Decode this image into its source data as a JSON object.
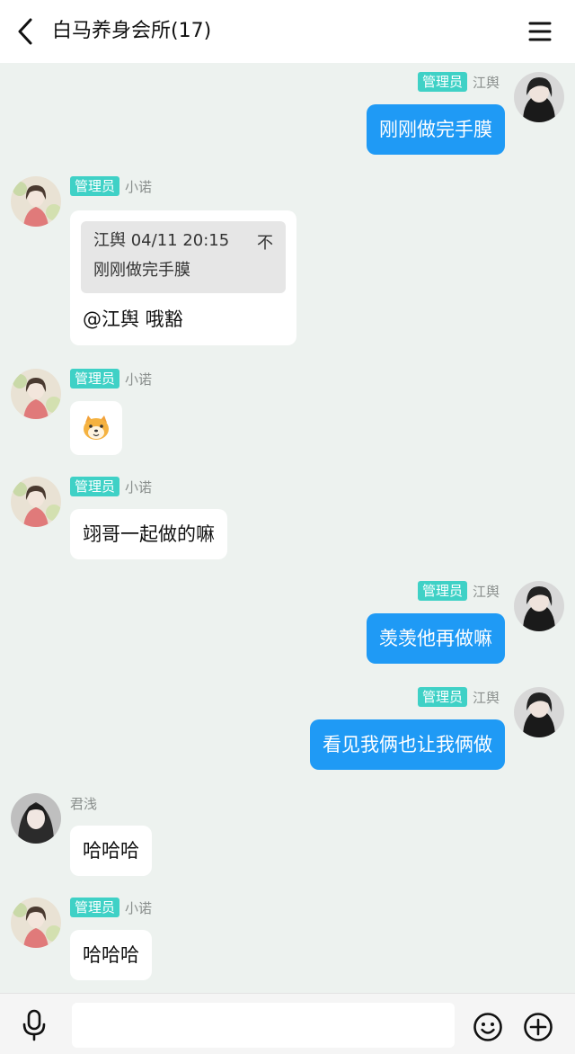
{
  "header": {
    "title": "白马养身会所(17)",
    "back_icon": "chevron-left-icon",
    "menu_icon": "hamburger-menu-icon"
  },
  "messages": [
    {
      "side": "right",
      "badge": "管理员",
      "sender": "江舆",
      "text": "刚刚做完手膜"
    },
    {
      "side": "left",
      "badge": "管理员",
      "sender": "小诺",
      "quote": {
        "author": "江舆",
        "time": "04/11 20:15",
        "pin": "不",
        "text": "刚刚做完手膜"
      },
      "text": "@江舆 哦豁"
    },
    {
      "side": "left",
      "badge": "管理员",
      "sender": "小诺",
      "sticker": "shiba-dog-emoji"
    },
    {
      "side": "left",
      "badge": "管理员",
      "sender": "小诺",
      "text": "翊哥一起做的嘛"
    },
    {
      "side": "right",
      "badge": "管理员",
      "sender": "江舆",
      "text": "羡羡他再做嘛"
    },
    {
      "side": "right",
      "badge": "管理员",
      "sender": "江舆",
      "text": "看见我俩也让我俩做"
    },
    {
      "side": "left",
      "sender": "君浅",
      "text": "哈哈哈"
    },
    {
      "side": "left",
      "badge": "管理员",
      "sender": "小诺",
      "text": "哈哈哈"
    }
  ],
  "input": {
    "value": "",
    "placeholder": "",
    "mic_icon": "microphone-icon",
    "emoji_icon": "smiley-emoji-icon",
    "plus_icon": "plus-circle-icon"
  },
  "colors": {
    "chat_bg": "#edf2ef",
    "outgoing_bubble": "#1f9af5",
    "admin_badge": "#3fd1c6"
  }
}
